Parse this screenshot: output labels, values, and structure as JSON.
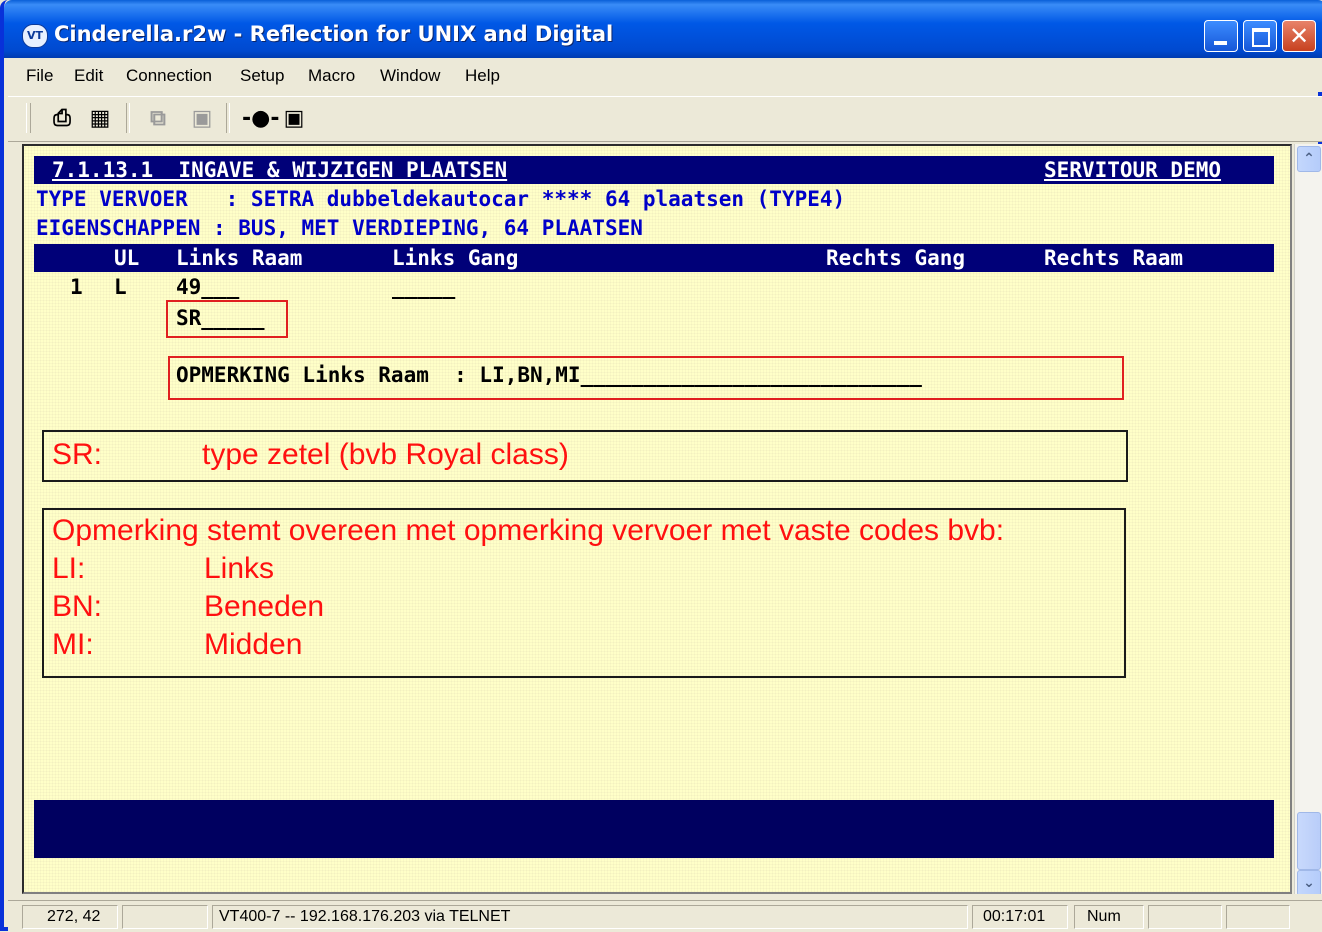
{
  "window": {
    "title": "Cinderella.r2w - Reflection for UNIX and Digital",
    "app_icon_label": "VT"
  },
  "menu": [
    "File",
    "Edit",
    "Connection",
    "Setup",
    "Macro",
    "Window",
    "Help"
  ],
  "toolbar_icons": [
    "print-icon",
    "print-setup-icon",
    "copy-icon",
    "paste-icon",
    "connect-icon",
    "chart-icon"
  ],
  "terminal": {
    "header_left": "7.1.13.1  INGAVE & WIJZIGEN PLAATSEN",
    "header_right": "SERVITOUR DEMO",
    "type_vervoer": "TYPE VERVOER   : SETRA dubbeldekautocar **** 64 plaatsen (TYPE4)",
    "eigenschappen": "EIGENSCHAPPEN : BUS, MET VERDIEPING, 64 PLAATSEN",
    "columns": {
      "ul": "UL",
      "links_raam": "Links Raam",
      "links_gang": "Links Gang",
      "rechts_gang": "Rechts Gang",
      "rechts_raam": "Rechts Raam"
    },
    "row": {
      "number": "1",
      "ul_value": "L",
      "links_raam_value": "49___",
      "links_gang_value": "_____",
      "seat_type": "SR_____"
    },
    "opmerking_line": "OPMERKING Links Raam  : LI,BN,MI___________________________"
  },
  "annotations": {
    "sr_key": "SR:",
    "sr_desc": "type zetel (bvb Royal class)",
    "opm_title": "Opmerking stemt overeen met opmerking vervoer met vaste codes bvb:",
    "codes": [
      {
        "code": "LI:",
        "meaning": "Links"
      },
      {
        "code": "BN:",
        "meaning": "Beneden"
      },
      {
        "code": "MI:",
        "meaning": "Midden"
      }
    ]
  },
  "status": {
    "cursor": "272, 42",
    "connection": "VT400-7 -- 192.168.176.203 via TELNET",
    "time": "00:17:01",
    "num": "Num"
  },
  "colors": {
    "terminal_bg": "#ffffc8",
    "band": "#000078",
    "field_text": "#0000c8",
    "annotation_red": "#ff1010",
    "titlebar": "#0058e6"
  }
}
